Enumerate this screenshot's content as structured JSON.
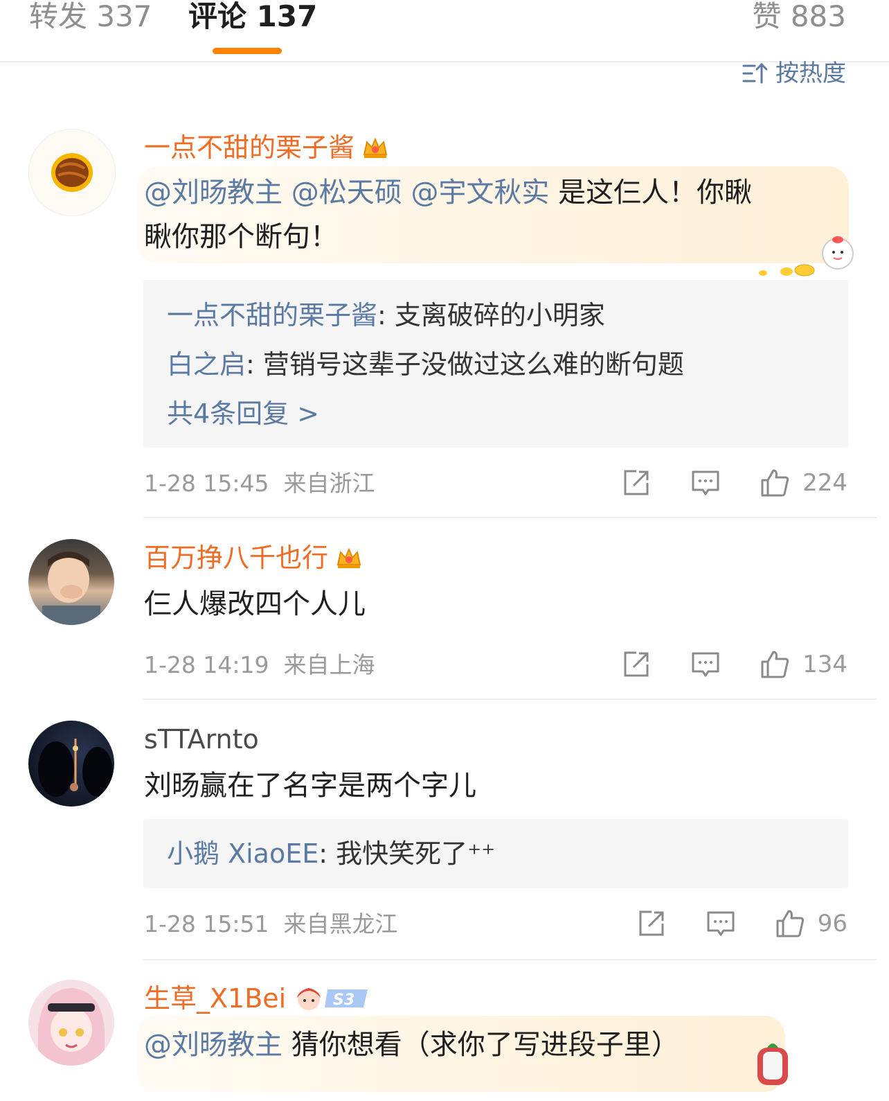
{
  "tabs": {
    "repost": "转发 337",
    "comment": "评论 137",
    "like": "赞 883",
    "active_color": "#ff8200"
  },
  "sort": {
    "label": "按热度",
    "icon": "sort-icon"
  },
  "comments": [
    {
      "username": "一点不甜的栗子酱",
      "avatar": "chestnut-avatar",
      "badge": "crown-icon",
      "mentions": [
        "@刘旸教主",
        "@松天硕",
        "@宇文秋实"
      ],
      "text_line1": "是这仨人！你瞅",
      "text_line2": "瞅你那个断句！",
      "replies": [
        {
          "name": "一点不甜的栗子酱",
          "text": ": 支离破碎的小明家"
        },
        {
          "name": "白之启",
          "text": ": 营销号这辈子没做过这么难的断句题"
        }
      ],
      "more_replies": "共4条回复 >",
      "time": "1-28 15:45",
      "location": "来自浙江",
      "likes": "224"
    },
    {
      "username": "百万挣八千也行",
      "avatar": "child-photo-avatar",
      "badge": "crown-icon",
      "text": "仨人爆改四个人儿",
      "time": "1-28 14:19",
      "location": "来自上海",
      "likes": "134"
    },
    {
      "username": "sTTArnto",
      "avatar": "night-tower-avatar",
      "text": "刘旸赢在了名字是两个字儿",
      "replies": [
        {
          "name": "小鹅 XiaoEE",
          "text": ": 我快笑死了⁺⁺"
        }
      ],
      "time": "1-28 15:51",
      "location": "来自黑龙江",
      "likes": "96"
    },
    {
      "username": "生草_X1Bei",
      "avatar": "anime-girl-avatar",
      "badge": "s3-badge",
      "badge_text": "S3",
      "mention": "@刘旸教主",
      "text": "猜你想看（求你了写进段子里）"
    }
  ],
  "colors": {
    "username": "#f06b23",
    "link": "#5b7aa3",
    "meta": "#9a9a9a"
  }
}
